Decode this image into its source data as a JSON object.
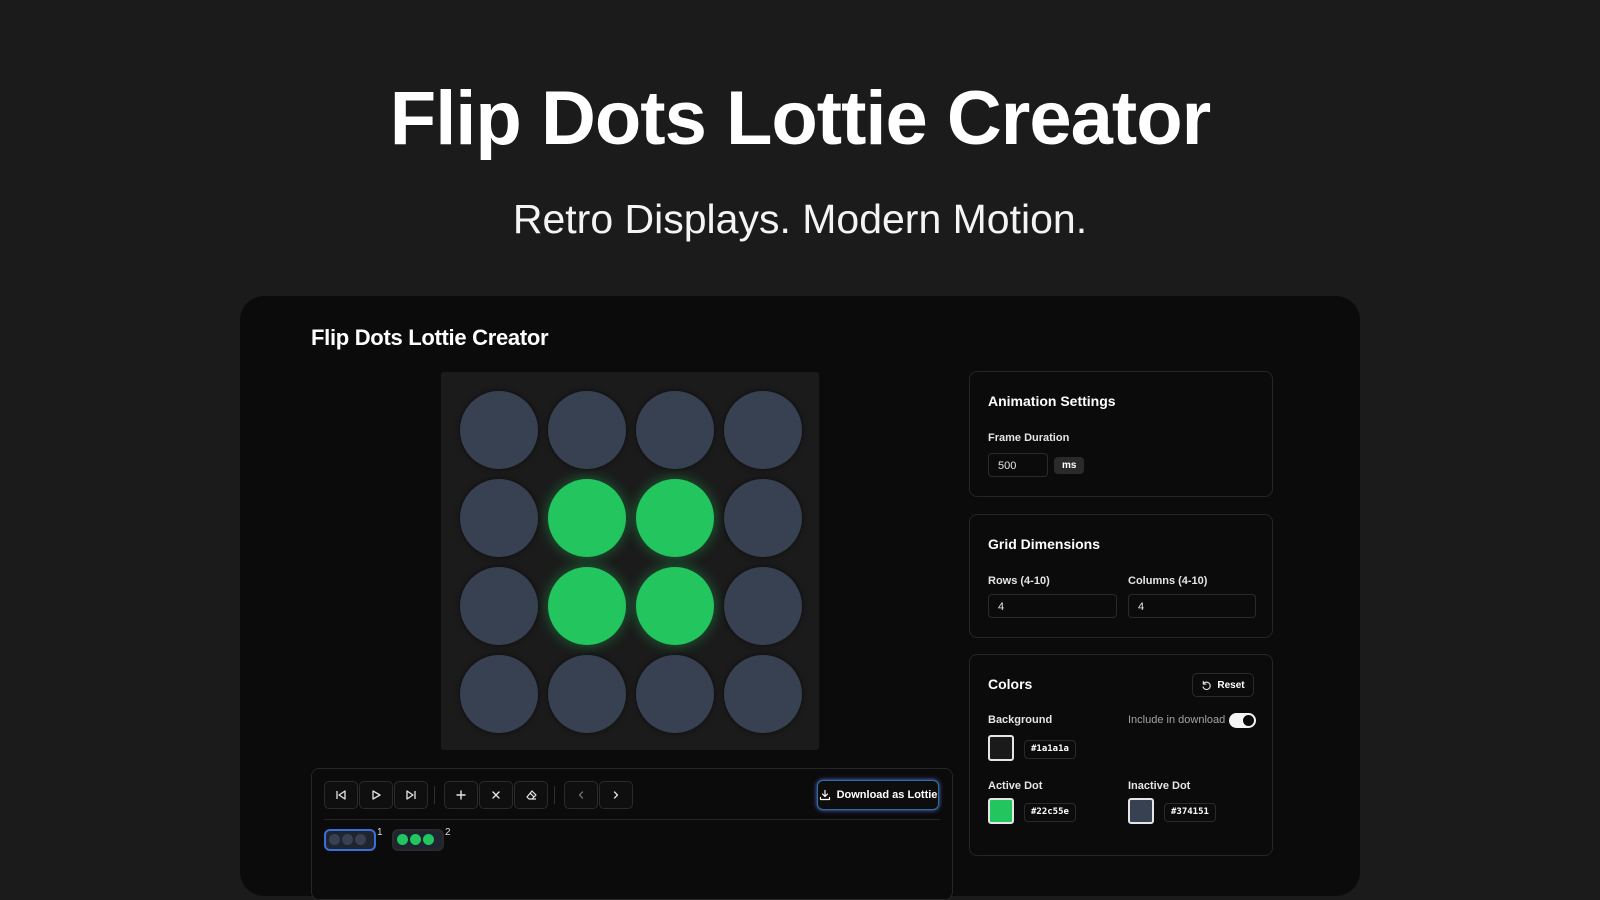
{
  "hero": {
    "title": "Flip Dots Lottie Creator",
    "subtitle": "Retro Displays. Modern Motion."
  },
  "app": {
    "title": "Flip Dots Lottie Creator"
  },
  "grid": {
    "rows": 4,
    "cols": 4,
    "cells": [
      [
        0,
        0,
        0,
        0
      ],
      [
        0,
        1,
        1,
        0
      ],
      [
        0,
        1,
        1,
        0
      ],
      [
        0,
        0,
        0,
        0
      ]
    ]
  },
  "toolbar": {
    "buttons": [
      {
        "icon": "skip-back-icon"
      },
      {
        "icon": "play-icon"
      },
      {
        "icon": "skip-forward-icon"
      },
      {
        "icon": "plus-icon"
      },
      {
        "icon": "x-icon"
      },
      {
        "icon": "eraser-icon"
      },
      {
        "icon": "chevron-left-icon"
      },
      {
        "icon": "chevron-right-icon"
      }
    ],
    "download_label": "Download as Lottie"
  },
  "frames": [
    {
      "number": "1",
      "selected": true
    },
    {
      "number": "2",
      "selected": false
    }
  ],
  "animation_settings": {
    "title": "Animation Settings",
    "frame_duration_label": "Frame Duration",
    "frame_duration_value": "500",
    "unit": "ms"
  },
  "grid_dimensions": {
    "title": "Grid Dimensions",
    "rows_label": "Rows (4-10)",
    "rows_value": "4",
    "cols_label": "Columns (4-10)",
    "cols_value": "4"
  },
  "colors": {
    "title": "Colors",
    "reset_label": "Reset",
    "background_label": "Background",
    "include_label": "Include in download",
    "include_on": true,
    "background_hex": "#1a1a1a",
    "active_label": "Active Dot",
    "active_hex": "#22c55e",
    "inactive_label": "Inactive Dot",
    "inactive_hex": "#374151"
  }
}
